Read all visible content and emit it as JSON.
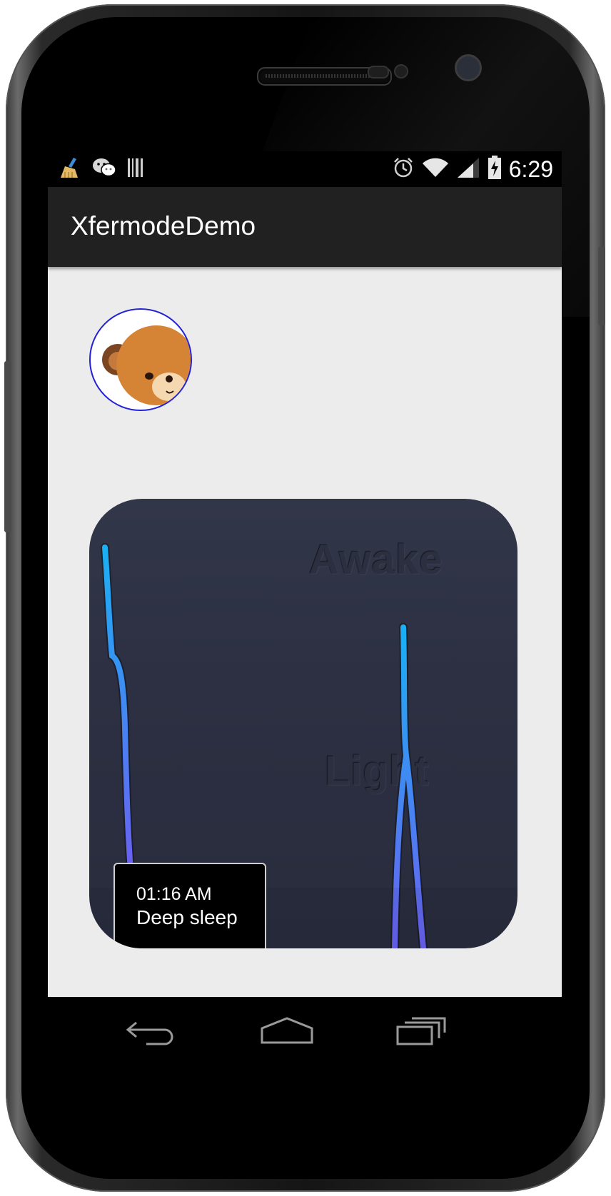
{
  "status_bar": {
    "time": "6:29",
    "left_icons": [
      "clean-broom-icon",
      "wechat-icon",
      "barcode-icon"
    ],
    "right_icons": [
      "alarm-icon",
      "wifi-icon",
      "cell-signal-icon",
      "battery-charging-icon"
    ]
  },
  "app": {
    "title": "XfermodeDemo"
  },
  "avatar": {
    "icon": "bear-avatar-icon",
    "border_color": "#2222d6"
  },
  "sleep_card": {
    "background_color": "#2d3144",
    "labels": [
      "Awake",
      "Light"
    ],
    "tooltip": {
      "time": "01:16 AM",
      "state": "Deep sleep"
    },
    "line_colors": [
      "#1ab0f5",
      "#6a60f0"
    ]
  },
  "nav_bar": {
    "buttons": [
      "back-icon",
      "home-icon",
      "recent-apps-icon"
    ]
  }
}
